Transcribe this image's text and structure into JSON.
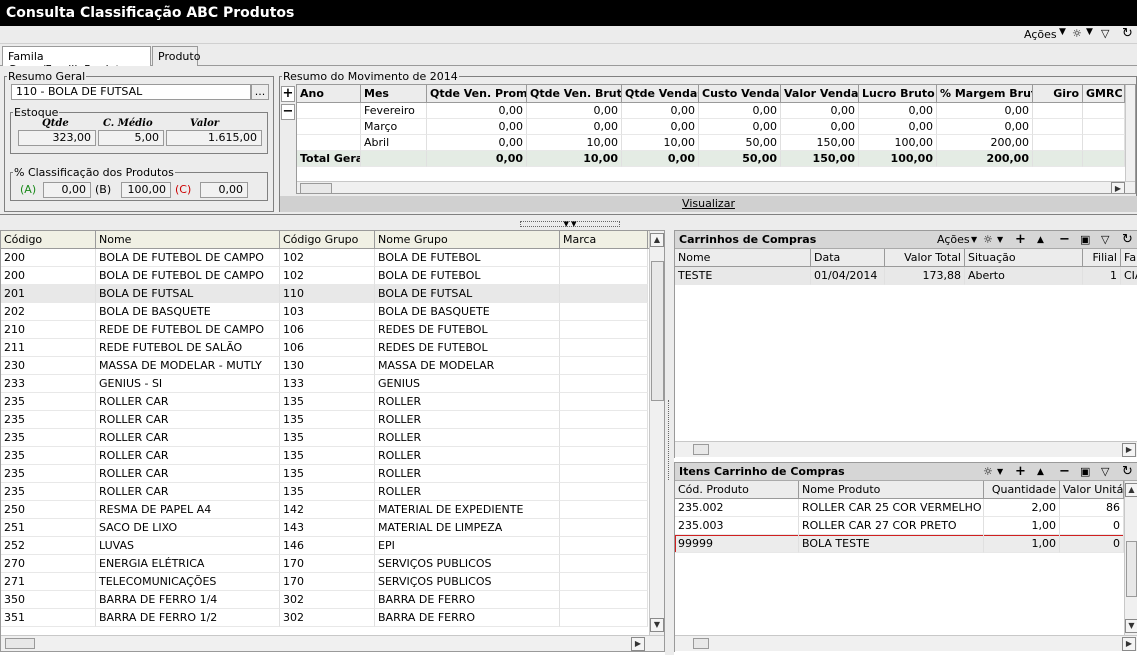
{
  "window": {
    "title": "Consulta Classificação ABC Produtos"
  },
  "toolbar": {
    "acoes": "Ações"
  },
  "tabs": [
    "Famila Grupo/FamiliaProduto",
    "Produto"
  ],
  "resumo_geral": {
    "legend": "Resumo Geral",
    "grupo_value": "110 - BOLA DE FUTSAL",
    "ellipsis": "...",
    "estoque": {
      "legend": "Estoque",
      "h_qtde": "Qtde",
      "h_cmedio": "C. Médio",
      "h_valor": "Valor",
      "qtde": "323,00",
      "cmedio": "5,00",
      "valor": "1.615,00"
    },
    "classif": {
      "legend": "% Classificação dos Produtos",
      "a_label": "(A)",
      "a_value": "0,00",
      "b_label": "(B)",
      "b_value": "100,00",
      "c_label": "(C)",
      "c_value": "0,00"
    },
    "colors": {
      "a": "#1a8a1a",
      "c": "#cc0000"
    }
  },
  "movimento": {
    "legend": "Resumo do Movimento de 2014",
    "columns": [
      "Ano",
      "Mes",
      "Qtde Ven. Promo",
      "Qtde Ven. Bruta",
      "Qtde Vendas",
      "Custo Vendas",
      "Valor Vendas",
      "Lucro Bruto",
      "% Margem Bruta",
      "Giro",
      "GMRC"
    ],
    "rows": [
      [
        "",
        "Fevereiro",
        "0,00",
        "0,00",
        "0,00",
        "0,00",
        "0,00",
        "0,00",
        "0,00",
        "",
        ""
      ],
      [
        "",
        "Março",
        "0,00",
        "0,00",
        "0,00",
        "0,00",
        "0,00",
        "0,00",
        "0,00",
        "",
        ""
      ],
      [
        "",
        "Abril",
        "0,00",
        "10,00",
        "10,00",
        "50,00",
        "150,00",
        "100,00",
        "200,00",
        "",
        ""
      ]
    ],
    "total": [
      "Total Geral",
      "",
      "0,00",
      "10,00",
      "0,00",
      "50,00",
      "150,00",
      "100,00",
      "200,00",
      "",
      ""
    ],
    "visualizar": "Visualizar"
  },
  "produtos": {
    "columns": [
      "Código",
      "Nome",
      "Código Grupo",
      "Nome Grupo",
      "Marca"
    ],
    "rows": [
      [
        "200",
        "BOLA DE FUTEBOL DE CAMPO",
        "102",
        "BOLA DE FUTEBOL",
        ""
      ],
      [
        "200",
        "BOLA DE FUTEBOL DE CAMPO",
        "102",
        "BOLA DE FUTEBOL",
        ""
      ],
      [
        "201",
        "BOLA DE FUTSAL",
        "110",
        "BOLA DE FUTSAL",
        ""
      ],
      [
        "202",
        "BOLA DE BASQUETE",
        "103",
        "BOLA DE BASQUETE",
        ""
      ],
      [
        "210",
        "REDE DE FUTEBOL DE CAMPO",
        "106",
        "REDES DE FUTEBOL",
        ""
      ],
      [
        "211",
        "REDE FUTEBOL DE SALÃO",
        "106",
        "REDES DE FUTEBOL",
        ""
      ],
      [
        "230",
        "MASSA DE MODELAR - MUTLY",
        "130",
        "MASSA DE MODELAR",
        ""
      ],
      [
        "233",
        "GENIUS - SI",
        "133",
        "GENIUS",
        ""
      ],
      [
        "235",
        "ROLLER CAR",
        "135",
        "ROLLER",
        ""
      ],
      [
        "235",
        "ROLLER CAR",
        "135",
        "ROLLER",
        ""
      ],
      [
        "235",
        "ROLLER CAR",
        "135",
        "ROLLER",
        ""
      ],
      [
        "235",
        "ROLLER CAR",
        "135",
        "ROLLER",
        ""
      ],
      [
        "235",
        "ROLLER CAR",
        "135",
        "ROLLER",
        ""
      ],
      [
        "235",
        "ROLLER CAR",
        "135",
        "ROLLER",
        ""
      ],
      [
        "250",
        "RESMA DE PAPEL A4",
        "142",
        "MATERIAL DE EXPEDIENTE",
        ""
      ],
      [
        "251",
        "SACO DE LIXO",
        "143",
        "MATERIAL DE LIMPEZA",
        ""
      ],
      [
        "252",
        "LUVAS",
        "146",
        "EPI",
        ""
      ],
      [
        "270",
        "ENERGIA ELÉTRICA",
        "170",
        "SERVIÇOS PUBLICOS",
        ""
      ],
      [
        "271",
        "TELECOMUNICAÇÕES",
        "170",
        "SERVIÇOS PUBLICOS",
        ""
      ],
      [
        "350",
        "BARRA DE FERRO 1/4",
        "302",
        "BARRA DE FERRO",
        ""
      ],
      [
        "351",
        "BARRA DE FERRO 1/2",
        "302",
        "BARRA DE FERRO",
        ""
      ]
    ]
  },
  "carrinhos": {
    "title": "Carrinhos de Compras",
    "acoes": "Ações",
    "columns": [
      "Nome",
      "Data",
      "Valor Total",
      "Situação",
      "Filial",
      "Fa"
    ],
    "rows": [
      [
        "TESTE",
        "01/04/2014",
        "173,88",
        "Aberto",
        "1",
        "CIA"
      ]
    ]
  },
  "itens": {
    "title": "Itens Carrinho de Compras",
    "columns": [
      "Cód. Produto",
      "Nome Produto",
      "Quantidade",
      "Valor Unitá"
    ],
    "rows": [
      [
        "235.002",
        "ROLLER CAR 25 COR VERMELHO",
        "2,00",
        "86"
      ],
      [
        "235.003",
        "ROLLER CAR 27 COR PRETO",
        "1,00",
        "0"
      ],
      [
        "99999",
        "BOLA TESTE",
        "1,00",
        "0"
      ]
    ]
  }
}
